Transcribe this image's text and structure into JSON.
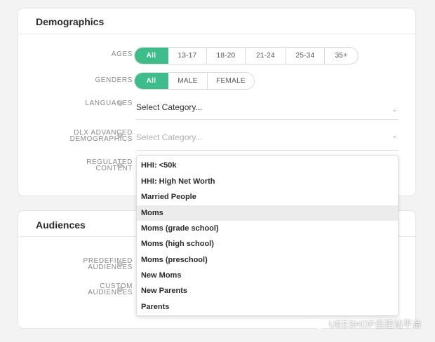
{
  "demographics": {
    "title": "Demographics",
    "ages": {
      "label": "AGES",
      "options": [
        "All",
        "13-17",
        "18-20",
        "21-24",
        "25-34",
        "35+"
      ],
      "selected": "All"
    },
    "genders": {
      "label": "GENDERS",
      "options": [
        "All",
        "MALE",
        "FEMALE"
      ],
      "selected": "All"
    },
    "languages": {
      "label": "LANGUAGES",
      "value": "Select Category..."
    },
    "dlx_advanced": {
      "label_line1": "DLX ADVANCED",
      "label_line2": "DEMOGRAPHICS",
      "placeholder": "Select Category..."
    },
    "regulated_content": {
      "label_line1": "REGULATED",
      "label_line2": "CONTENT"
    }
  },
  "dropdown": {
    "items": [
      "HHI: <50k",
      "HHI: High Net Worth",
      "Married People",
      "Moms",
      "Moms (grade school)",
      "Moms (high school)",
      "Moms (preschool)",
      "New Moms",
      "New Parents",
      "Parents"
    ],
    "highlighted": "Moms"
  },
  "audiences": {
    "title": "Audiences",
    "predefined": {
      "label_line1": "PREDEFINED",
      "label_line2": "AUDIENCES"
    },
    "custom": {
      "label_line1": "CUSTOM",
      "label_line2": "AUDIENCES"
    }
  },
  "watermark": {
    "text": "UEESHOP自建站平台"
  },
  "colors": {
    "accent": "#3dbd8a",
    "highlight": "#ececec"
  },
  "icons": {
    "info": "info-icon",
    "chevron_down": "chevron-down-icon",
    "chevron_up": "chevron-up-icon"
  }
}
